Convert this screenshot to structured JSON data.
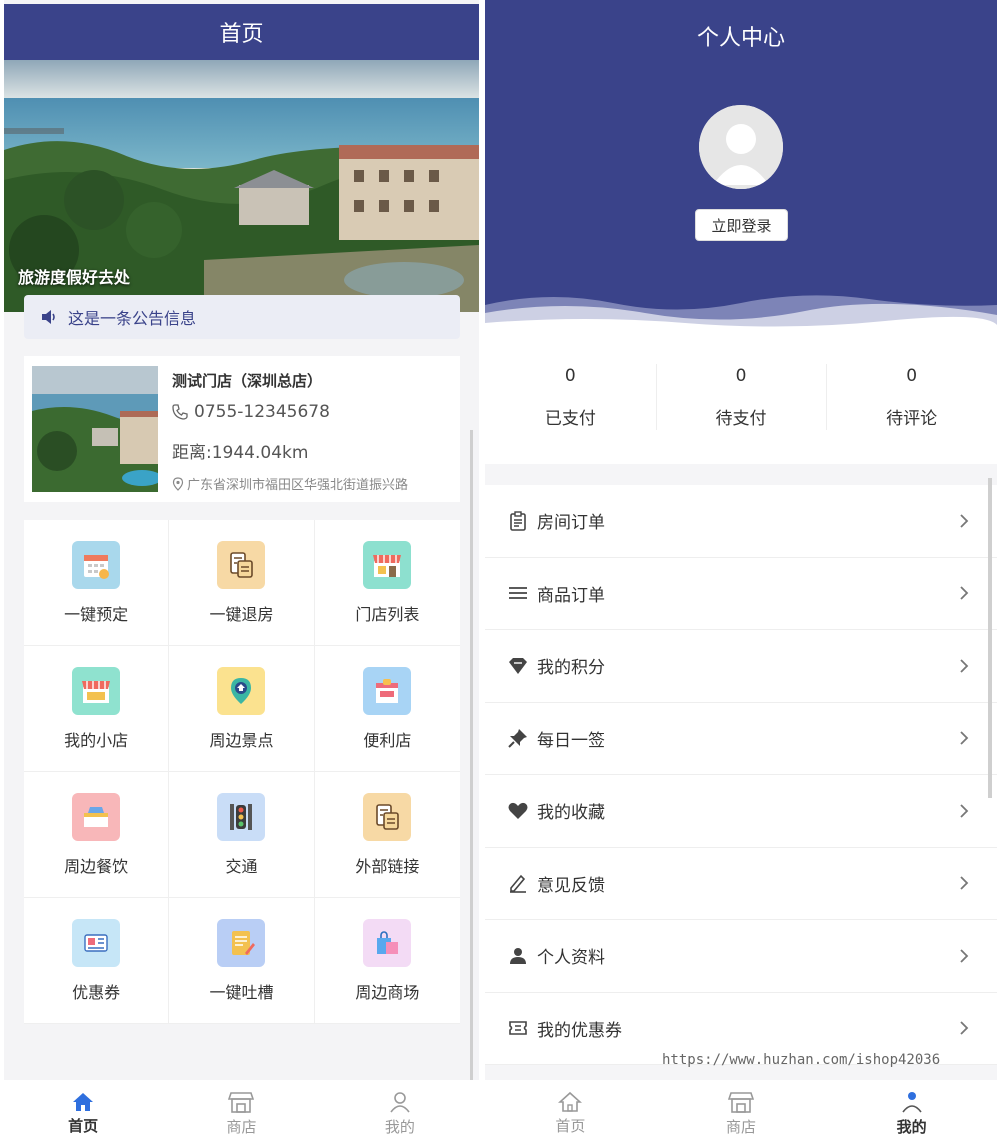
{
  "left": {
    "header_title": "首页",
    "banner_caption": "旅游度假好去处",
    "notice_text": "这是一条公告信息",
    "store": {
      "name": "测试门店（深圳总店）",
      "phone": "0755-12345678",
      "distance": "距离:1944.04km",
      "address": "广东省深圳市福田区华强北街道振兴路"
    },
    "grid": [
      {
        "label": "一键预定",
        "icon": "calendar-icon",
        "bg": "#a9d8ec"
      },
      {
        "label": "一键退房",
        "icon": "building-icon",
        "bg": "#f7d9a5"
      },
      {
        "label": "门店列表",
        "icon": "storefront-icon",
        "bg": "#8de0cf"
      },
      {
        "label": "我的小店",
        "icon": "shop-icon",
        "bg": "#8fe2cf"
      },
      {
        "label": "周边景点",
        "icon": "location-pin-icon",
        "bg": "#fbe28f"
      },
      {
        "label": "便利店",
        "icon": "convenience-store-icon",
        "bg": "#a8d4f5"
      },
      {
        "label": "周边餐饮",
        "icon": "dining-icon",
        "bg": "#f8b7b9"
      },
      {
        "label": "交通",
        "icon": "traffic-light-icon",
        "bg": "#c9ddf7"
      },
      {
        "label": "外部链接",
        "icon": "building-link-icon",
        "bg": "#f7d9a5"
      },
      {
        "label": "优惠券",
        "icon": "coupon-icon",
        "bg": "#c6e6f7"
      },
      {
        "label": "一键吐槽",
        "icon": "note-icon",
        "bg": "#b9cef5"
      },
      {
        "label": "周边商场",
        "icon": "shopping-bag-icon",
        "bg": "#f3dbf5"
      }
    ],
    "tabs": [
      {
        "label": "首页",
        "icon": "home-icon",
        "active": true
      },
      {
        "label": "商店",
        "icon": "store-icon",
        "active": false
      },
      {
        "label": "我的",
        "icon": "user-icon",
        "active": false
      }
    ]
  },
  "right": {
    "header_title": "个人中心",
    "login_label": "立即登录",
    "stats": [
      {
        "value": "0",
        "label": "已支付"
      },
      {
        "value": "0",
        "label": "待支付"
      },
      {
        "value": "0",
        "label": "待评论"
      }
    ],
    "menu": [
      {
        "label": "房间订单",
        "icon": "clipboard-icon"
      },
      {
        "label": "商品订单",
        "icon": "list-icon"
      },
      {
        "label": "我的积分",
        "icon": "diamond-icon"
      },
      {
        "label": "每日一签",
        "icon": "pin-icon"
      },
      {
        "label": "我的收藏",
        "icon": "heart-icon"
      },
      {
        "label": "意见反馈",
        "icon": "pencil-icon"
      },
      {
        "label": "个人资料",
        "icon": "person-icon"
      },
      {
        "label": "我的优惠券",
        "icon": "ticket-icon"
      }
    ],
    "tabs": [
      {
        "label": "首页",
        "icon": "home-icon",
        "active": false
      },
      {
        "label": "商店",
        "icon": "store-icon",
        "active": false
      },
      {
        "label": "我的",
        "icon": "user-icon",
        "active": true
      }
    ],
    "watermark": "https://www.huzhan.com/ishop42036"
  },
  "colors": {
    "brand": "#3a438a",
    "active_tab_icon": "#2f6fde"
  }
}
